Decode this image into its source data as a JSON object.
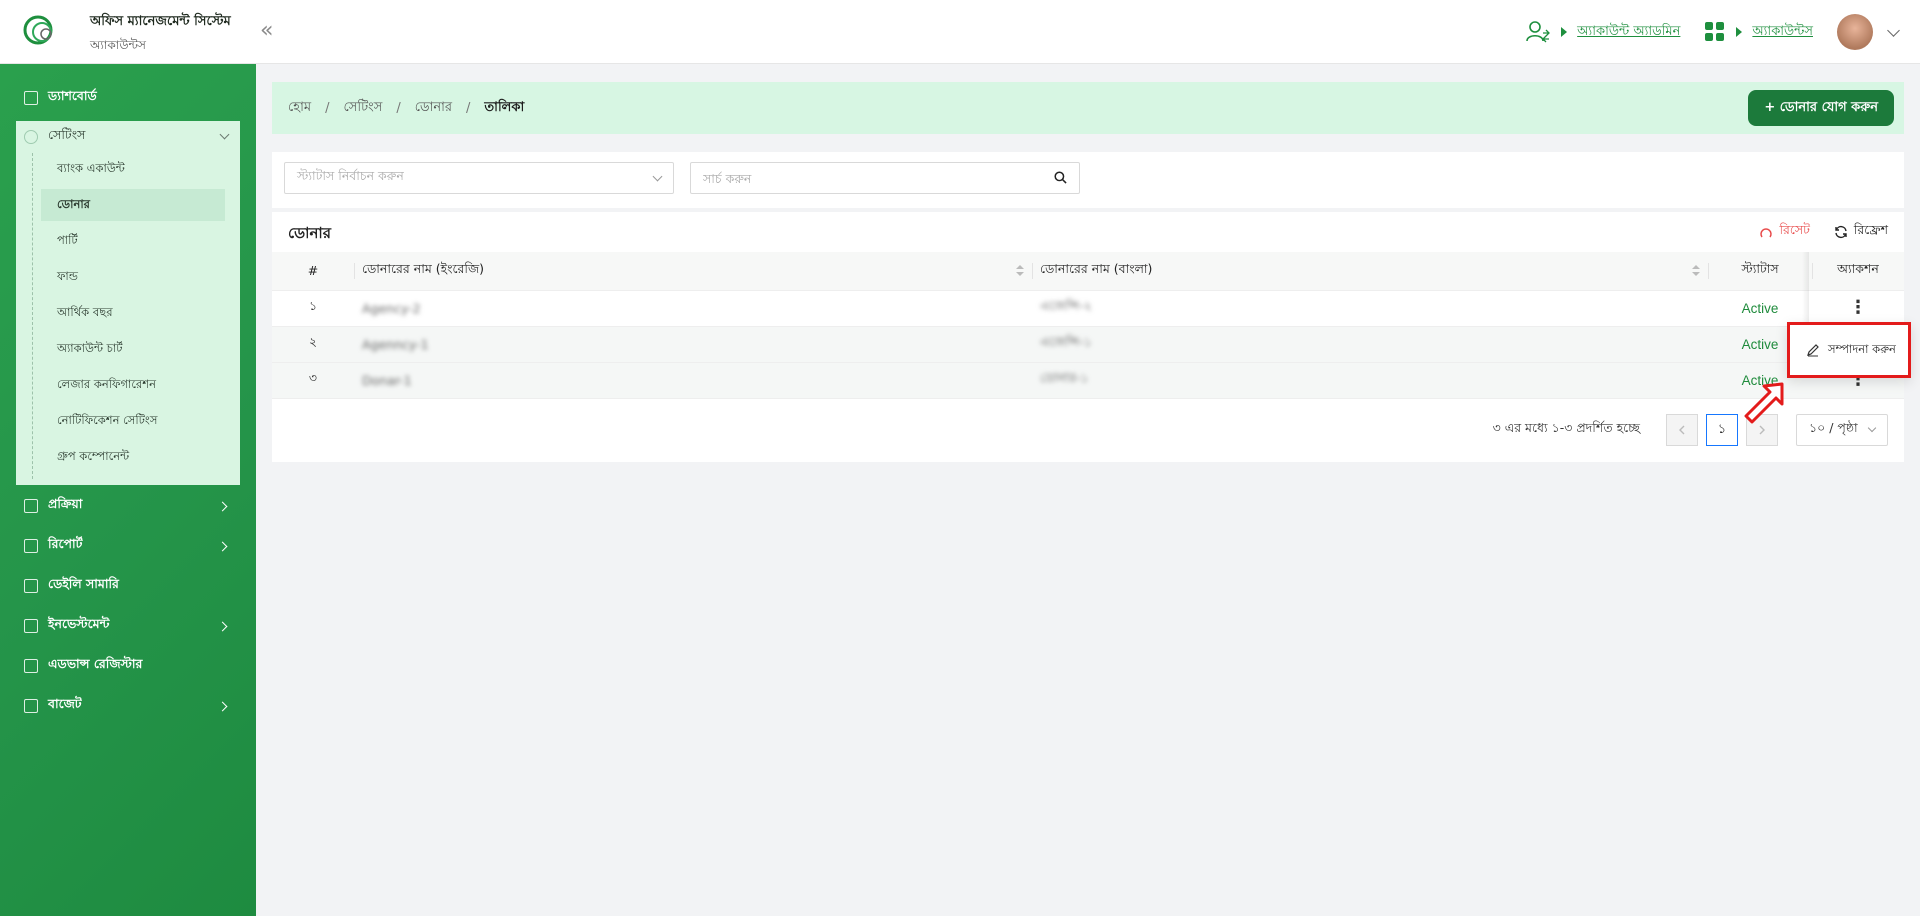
{
  "header": {
    "app_title": "অফিস ম্যানেজমেন্ট সিস্টেম",
    "app_subtitle": "অ্যাকাউন্টস",
    "collapse_icon": "double-chevron-left-icon",
    "user_role_link": "অ্যাকাউন্ট অ্যাডমিন",
    "module_link": "অ্যাকাউন্টস",
    "accent_color": "#1e8f3e"
  },
  "sidebar": {
    "dashboard": "ড্যাশবোর্ড",
    "settings": {
      "label": "সেটিংস",
      "items": [
        "ব্যাংক একাউন্ট",
        "ডোনার",
        "পার্টি",
        "ফান্ড",
        "আর্থিক বছর",
        "অ্যাকাউন্ট চার্ট",
        "লেজার কনফিগারেশন",
        "নোটিফিকেশন সেটিংস",
        "গ্রুপ কম্পোনেন্ট"
      ],
      "active_item": "ডোনার"
    },
    "bottom_items": [
      {
        "label": "প্রক্রিয়া",
        "has_children": true
      },
      {
        "label": "রিপোর্ট",
        "has_children": true
      },
      {
        "label": "ডেইলি সামারি",
        "has_children": false
      },
      {
        "label": "ইনভেস্টমেন্ট",
        "has_children": true
      },
      {
        "label": "এডভান্স রেজিস্টার",
        "has_children": false
      },
      {
        "label": "বাজেট",
        "has_children": true
      }
    ]
  },
  "breadcrumb": {
    "items": [
      "হোম",
      "সেটিংস",
      "ডোনার",
      "তালিকা"
    ],
    "add_button": "+ ডোনার যোগ করুন"
  },
  "filters": {
    "status_placeholder": "স্ট্যাটাস নির্বাচন করুন",
    "search_placeholder": "সার্চ করুন"
  },
  "table": {
    "title": "ডোনার",
    "reset_label": "রিসেট",
    "refresh_label": "রিফ্রেশ",
    "columns": [
      "#",
      "ডোনারের নাম (ইংরেজি)",
      "ডোনারের নাম (বাংলা)",
      "স্ট্যাটাস",
      "অ্যাকশন"
    ],
    "rows": [
      {
        "num": "১",
        "name_en": "Agency-2",
        "name_bn": "এজেন্সি-২",
        "status": "Active"
      },
      {
        "num": "২",
        "name_en": "Agenncy-1",
        "name_bn": "এজেন্সি-১",
        "status": "Active"
      },
      {
        "num": "৩",
        "name_en": "Donar-1",
        "name_bn": "ডোনার-১",
        "status": "Active"
      }
    ],
    "status_color": "#1f8b3c"
  },
  "pagination": {
    "summary": "৩ এর মধ্যে ১-৩ প্রদর্শিত হচ্ছে",
    "current_page": "১",
    "page_size": "১০ / পৃষ্ঠা"
  },
  "action_menu": {
    "edit_label": "সম্পাদনা করুন",
    "highlight_color": "#e31b1b"
  }
}
